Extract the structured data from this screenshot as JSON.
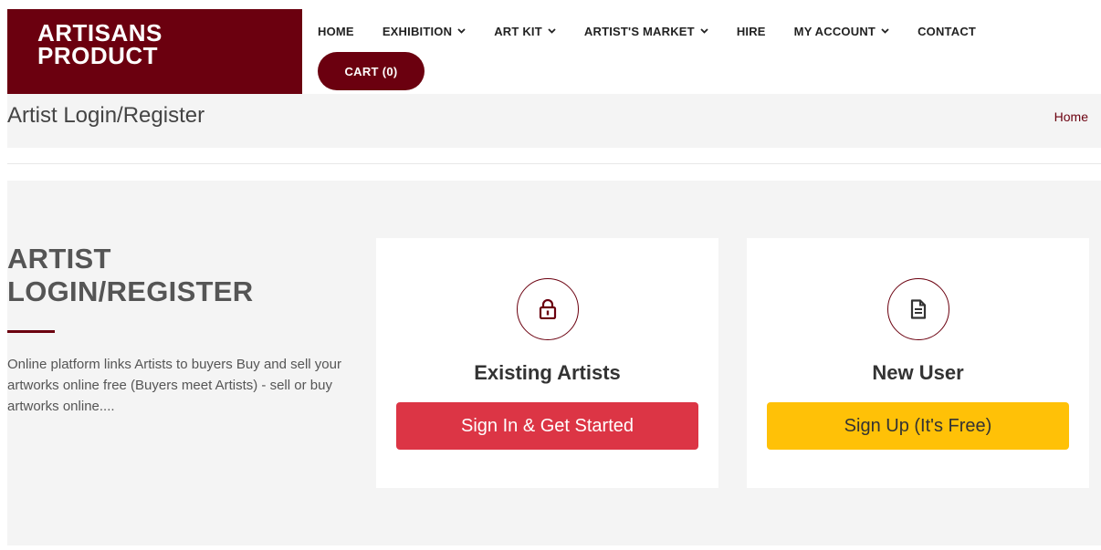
{
  "brand": {
    "line1": "ARTISANS",
    "line2": "PRODUCT",
    "color": "#6b000f"
  },
  "nav": {
    "items": [
      {
        "label": "HOME",
        "dropdown": false
      },
      {
        "label": "EXHIBITION",
        "dropdown": true
      },
      {
        "label": "ART KIT",
        "dropdown": true
      },
      {
        "label": "ARTIST'S MARKET",
        "dropdown": true
      },
      {
        "label": "HIRE",
        "dropdown": false
      },
      {
        "label": "MY ACCOUNT",
        "dropdown": true
      },
      {
        "label": "CONTACT",
        "dropdown": false
      }
    ],
    "cart_label": "CART (0)",
    "chevron_icon": "chevron-down-icon"
  },
  "title_bar": {
    "title": "Artist Login/Register",
    "breadcrumb": "Home"
  },
  "section": {
    "heading_line1": "ARTIST",
    "heading_line2": "LOGIN/REGISTER",
    "description": "Online platform links Artists to buyers Buy and sell your artworks online free (Buyers meet Artists) - sell or buy artworks online...."
  },
  "cards": {
    "existing": {
      "icon": "lock-icon",
      "title": "Existing Artists",
      "button_label": "Sign In & Get Started",
      "button_color": "#dc3545"
    },
    "new_user": {
      "icon": "document-icon",
      "title": "New User",
      "button_label": "Sign Up (It's Free)",
      "button_color": "#ffc107"
    }
  }
}
